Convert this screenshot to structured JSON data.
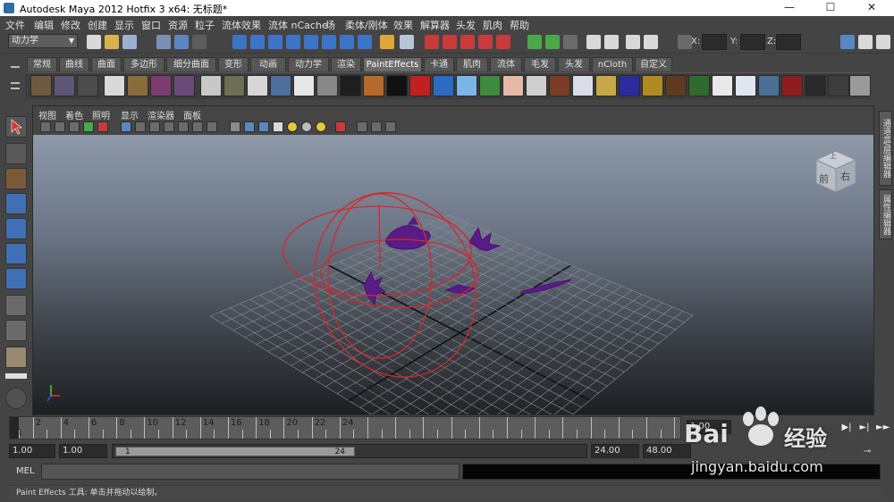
{
  "window": {
    "title": "Autodesk Maya 2012 Hotfix 3 x64: 无标题*",
    "controls": [
      "—",
      "☐",
      "✕"
    ]
  },
  "menubar": [
    "文件",
    "编辑",
    "修改",
    "创建",
    "显示",
    "窗口",
    "资源",
    "粒子",
    "流体效果",
    "流体 nCache",
    "场",
    "柔体/刚体",
    "效果",
    "解算器",
    "头发",
    "肌肉",
    "帮助"
  ],
  "statusline": {
    "mode": "动力学",
    "x_label": "X:",
    "y_label": "Y:",
    "z_label": "Z:"
  },
  "shelf_tabs": [
    "常规",
    "曲线",
    "曲面",
    "多边形",
    "细分曲面",
    "变形",
    "动画",
    "动力学",
    "渲染",
    "PaintEffects",
    "卡通",
    "肌肉",
    "流体",
    "毛发",
    "头发",
    "nCloth",
    "自定义"
  ],
  "active_shelf_tab": "PaintEffects",
  "panel_menu": [
    "视图",
    "着色",
    "照明",
    "显示",
    "渲染器",
    "面板"
  ],
  "viewcube": {
    "front": "前",
    "right": "右",
    "top": "上"
  },
  "right_tabs": [
    "通道盒/层编辑器",
    "属性编辑器"
  ],
  "time_slider": {
    "tick_labels": [
      "2",
      "4",
      "6",
      "8",
      "10",
      "12",
      "14",
      "16",
      "18",
      "20",
      "22",
      "24"
    ],
    "start_label": "1",
    "current_frame": "1.00"
  },
  "range_slider": {
    "start_time": "1.00",
    "range_start": "1.00",
    "handle_start": "1",
    "handle_end": "24",
    "range_end": "24.00",
    "end_time": "48.00"
  },
  "command_line": {
    "label": "MEL"
  },
  "help_line": "Paint Effects 工具: 单击并拖动以绘制。",
  "watermark": {
    "brand": "Bai",
    "brand_cn": "经验",
    "url": "jingyan.baidu.com"
  },
  "colors": {
    "ui_bg": "#444444",
    "viewport_top": "#8e9aa9",
    "viewport_bottom": "#1d1f22",
    "guide_red": "#d8262b",
    "stroke_purple": "#5a1b86"
  }
}
